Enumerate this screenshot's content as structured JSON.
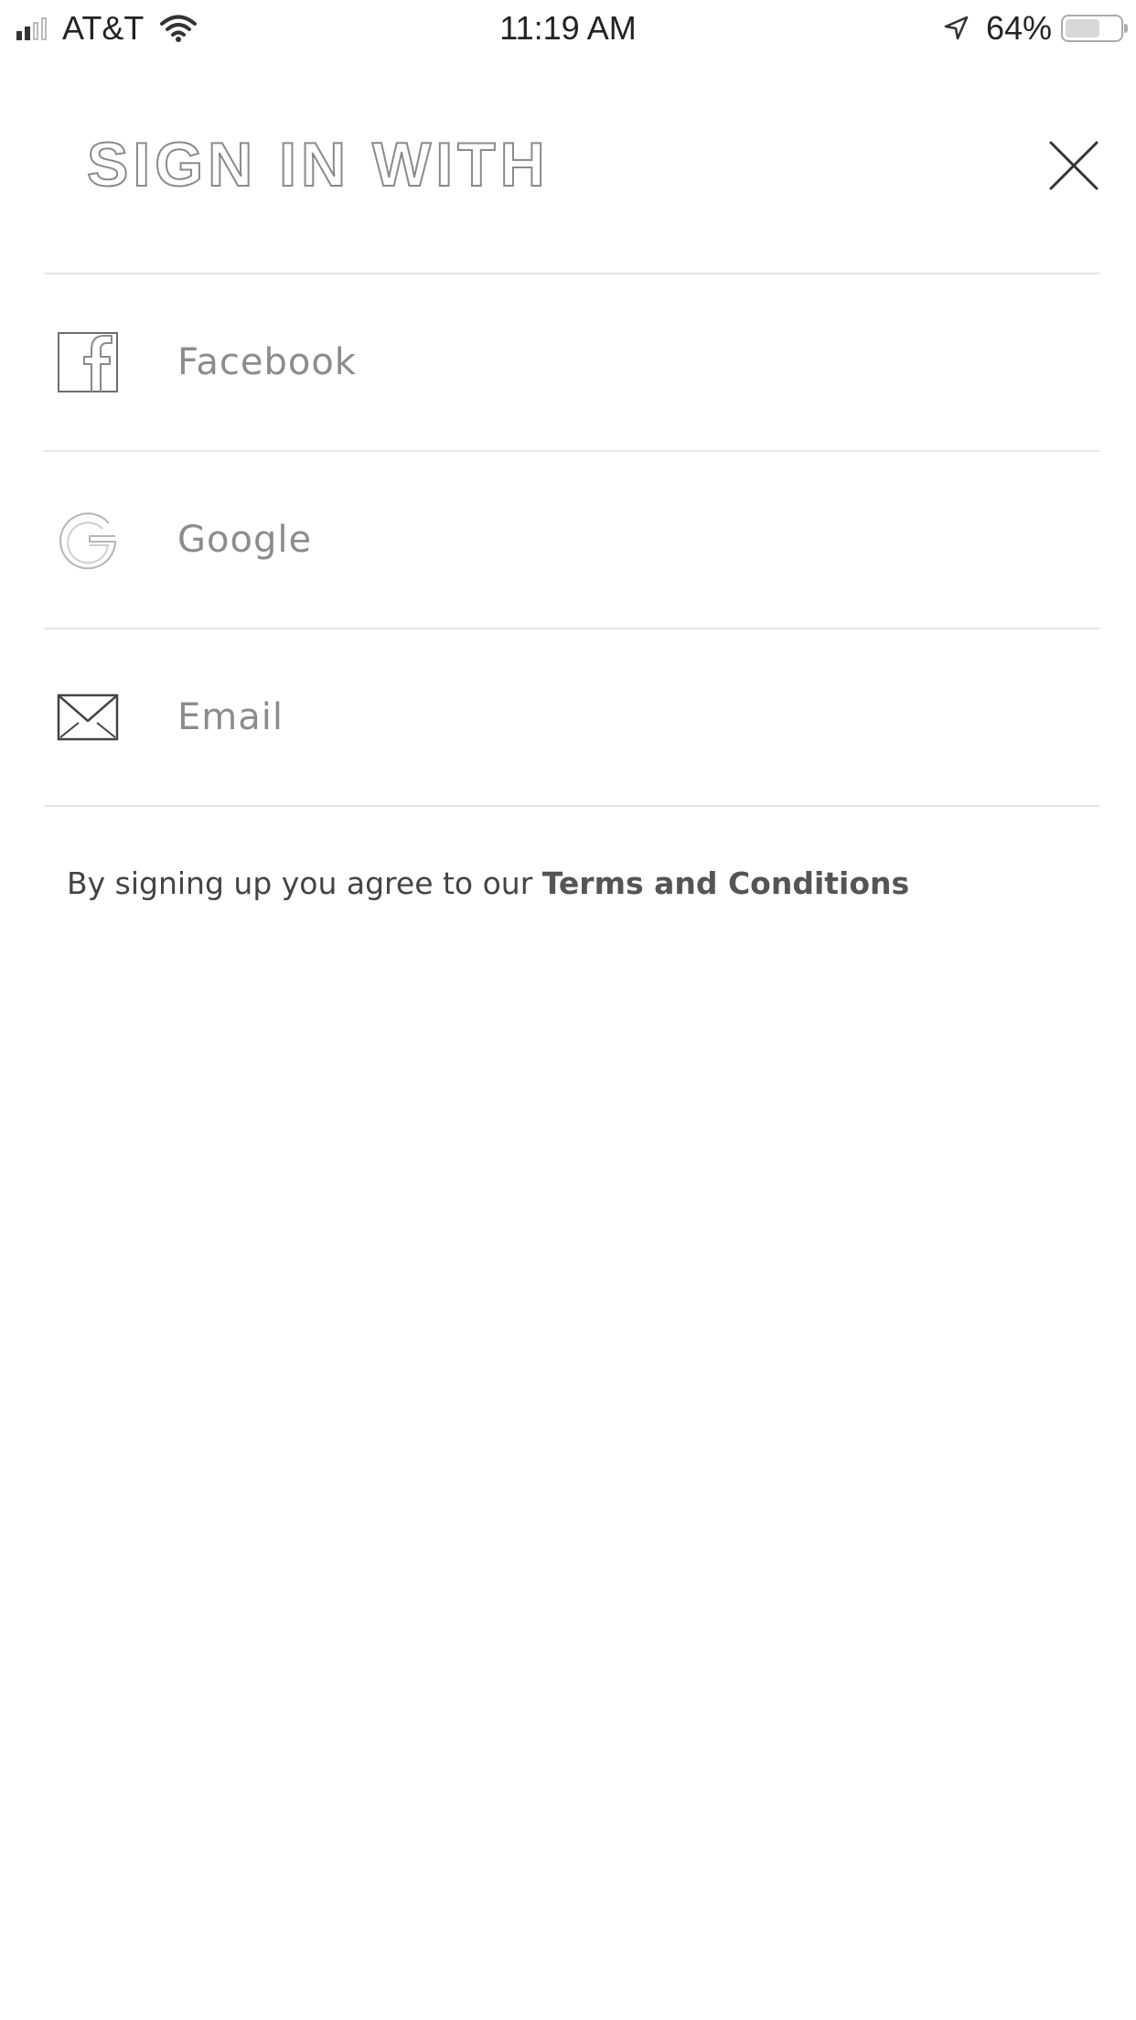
{
  "status_bar": {
    "carrier": "AT&T",
    "time": "11:19 AM",
    "battery_percent_label": "64%",
    "battery_level": 0.64,
    "signal_bars_filled": 2,
    "signal_bars_total": 4
  },
  "header": {
    "title": "SIGN IN WITH",
    "close_icon": "close-icon"
  },
  "options": [
    {
      "label": "Facebook",
      "icon": "facebook-icon"
    },
    {
      "label": "Google",
      "icon": "google-icon"
    },
    {
      "label": "Email",
      "icon": "envelope-icon"
    }
  ],
  "footer": {
    "terms_prefix": "By signing up you agree to our ",
    "terms_link": "Terms and Conditions"
  },
  "colors": {
    "background": "#ffffff",
    "divider": "#e6e6e6",
    "label": "#8c8c8c",
    "title_outline": "#8a8a8a"
  }
}
